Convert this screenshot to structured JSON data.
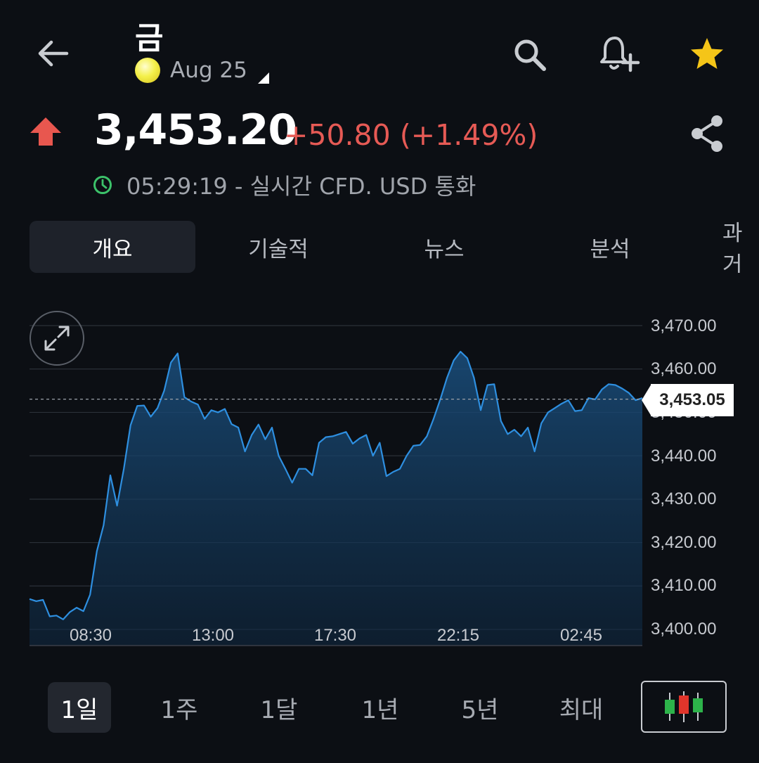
{
  "header": {
    "back_icon": "arrow-left-icon",
    "title": "금",
    "contract": "Aug 25",
    "search_icon": "search-icon",
    "alert_icon": "bell-plus-icon",
    "favorite_icon": "star-icon",
    "favorite_color": "#f5c518"
  },
  "quote": {
    "price": "3,453.20",
    "change": "+50.80 (+1.49%)",
    "direction": "up",
    "change_color": "#e65a55",
    "time_info": "05:29:19 - 실시간 CFD. USD 통화",
    "share_icon": "share-icon"
  },
  "tabs": [
    {
      "label": "개요",
      "active": true
    },
    {
      "label": "기술적",
      "active": false
    },
    {
      "label": "뉴스",
      "active": false
    },
    {
      "label": "분석",
      "active": false
    },
    {
      "label": "과거",
      "active": false
    }
  ],
  "chart_data": {
    "type": "area",
    "title": "",
    "xlabel": "",
    "ylabel": "",
    "ylim": [
      3400,
      3470
    ],
    "yticks": [
      "3,470.00",
      "3,460.00",
      "3,450.00",
      "3,440.00",
      "3,430.00",
      "3,420.00",
      "3,410.00",
      "3,400.00"
    ],
    "xticks": [
      "08:30",
      "13:00",
      "17:30",
      "22:15",
      "02:45"
    ],
    "current_value": "3,453.05",
    "grid": true,
    "line_color": "#2e8fe0",
    "series": [
      {
        "values": [
          3407,
          3406.5,
          3406.8,
          3403,
          3403.2,
          3402.3,
          3404,
          3405,
          3404.2,
          3408,
          3418,
          3424,
          3435.5,
          3428.5,
          3437,
          3447,
          3451.5,
          3451.6,
          3449,
          3451,
          3455,
          3461.5,
          3463.6,
          3453.5,
          3452.5,
          3451.8,
          3448.5,
          3450.5,
          3450,
          3450.8,
          3447.3,
          3446.5,
          3441,
          3444.8,
          3447.2,
          3443.8,
          3446.5,
          3440,
          3437,
          3433.8,
          3437,
          3437,
          3435.5,
          3443,
          3444.3,
          3444.5,
          3445,
          3445.5,
          3442.8,
          3444,
          3444.8,
          3440,
          3443,
          3435.3,
          3436.3,
          3437,
          3440,
          3442.3,
          3442.5,
          3444.5,
          3448.5,
          3453,
          3458,
          3462,
          3464,
          3462.5,
          3458,
          3450.5,
          3456.3,
          3456.5,
          3448,
          3445,
          3446,
          3444.5,
          3446.5,
          3441,
          3447.5,
          3450,
          3451,
          3452,
          3452.8,
          3450.3,
          3450.5,
          3453.3,
          3453,
          3455.3,
          3456.5,
          3456.3,
          3455.5,
          3454.5,
          3452.8,
          3453.3
        ]
      }
    ]
  },
  "expand_icon": "expand-icon",
  "periods": [
    {
      "label": "1일",
      "active": true
    },
    {
      "label": "1주",
      "active": false
    },
    {
      "label": "1달",
      "active": false
    },
    {
      "label": "1년",
      "active": false
    },
    {
      "label": "5년",
      "active": false
    },
    {
      "label": "최대",
      "active": false
    }
  ],
  "candlestick_icon": "candlestick-icon"
}
